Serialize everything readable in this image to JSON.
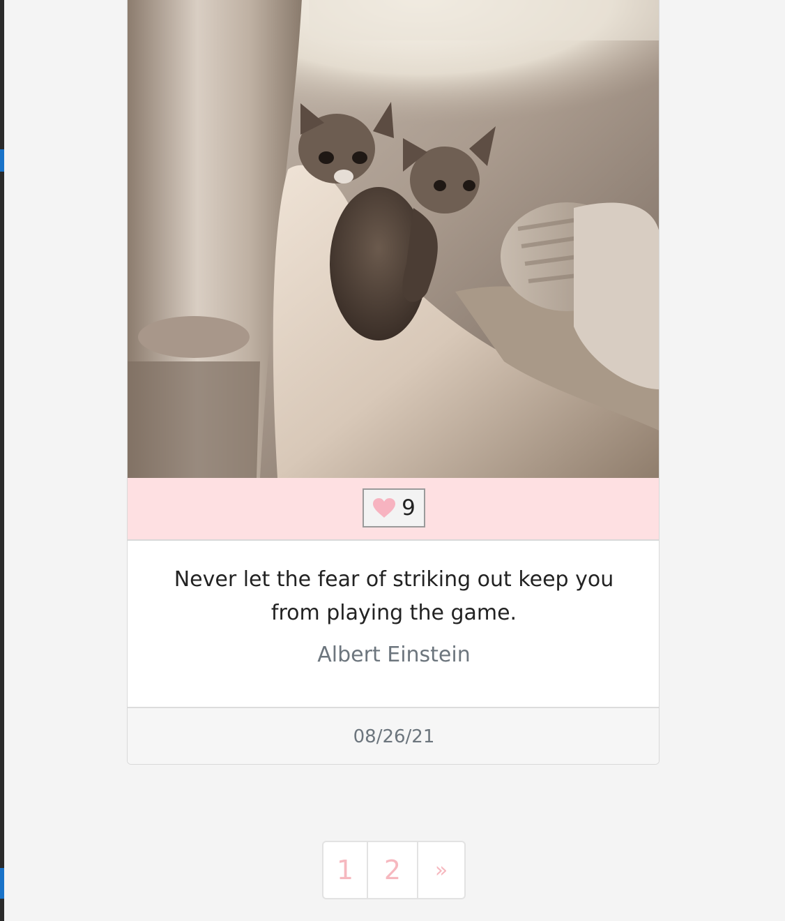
{
  "card": {
    "photo_alt": "two tabby kittens on a sofa arm",
    "like_count": "9",
    "quote": "Never let the fear of striking out keep you from playing the game.",
    "author": "Albert Einstein",
    "date": "08/26/21"
  },
  "pagination": {
    "pages": [
      "1",
      "2"
    ],
    "next": "»"
  },
  "colors": {
    "like_bar": "#fee0e2",
    "heart": "#f7b3c0",
    "pagination_text": "#f6b8bf",
    "muted_text": "#6c757d"
  },
  "icons": {
    "like": "heart-icon"
  }
}
